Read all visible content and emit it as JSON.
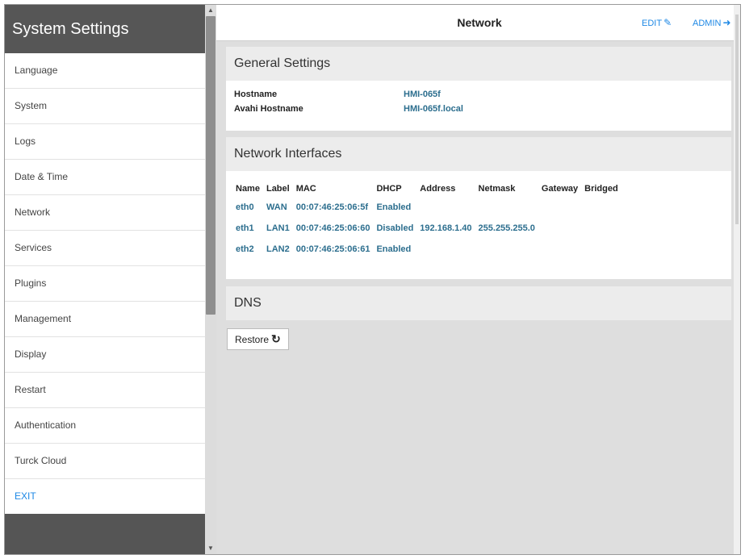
{
  "sidebar": {
    "title": "System Settings",
    "items": [
      {
        "label": "Language"
      },
      {
        "label": "System"
      },
      {
        "label": "Logs"
      },
      {
        "label": "Date & Time"
      },
      {
        "label": "Network"
      },
      {
        "label": "Services"
      },
      {
        "label": "Plugins"
      },
      {
        "label": "Management"
      },
      {
        "label": "Display"
      },
      {
        "label": "Restart"
      },
      {
        "label": "Authentication"
      },
      {
        "label": "Turck Cloud"
      },
      {
        "label": "EXIT"
      }
    ]
  },
  "topbar": {
    "title": "Network",
    "edit_label": "EDIT",
    "admin_label": "ADMIN"
  },
  "general": {
    "heading": "General Settings",
    "rows": [
      {
        "key": "Hostname",
        "value": "HMI-065f"
      },
      {
        "key": "Avahi Hostname",
        "value": "HMI-065f.local"
      }
    ]
  },
  "interfaces": {
    "heading": "Network Interfaces",
    "columns": [
      "Name",
      "Label",
      "MAC",
      "DHCP",
      "Address",
      "Netmask",
      "Gateway",
      "Bridged"
    ],
    "rows": [
      [
        "eth0",
        "WAN",
        "00:07:46:25:06:5f",
        "Enabled",
        "",
        "",
        "",
        ""
      ],
      [
        "eth1",
        "LAN1",
        "00:07:46:25:06:60",
        "Disabled",
        "192.168.1.40",
        "255.255.255.0",
        "",
        ""
      ],
      [
        "eth2",
        "LAN2",
        "00:07:46:25:06:61",
        "Enabled",
        "",
        "",
        "",
        ""
      ]
    ]
  },
  "dns": {
    "heading": "DNS"
  },
  "restore": {
    "label": "Restore"
  },
  "icons": {
    "edit": "edit-icon",
    "admin": "sign-out-icon",
    "restore": "refresh-icon"
  },
  "colors": {
    "accent": "#1e88e5",
    "value_text": "#2c6e8e",
    "sidebar_bg": "#555555"
  }
}
